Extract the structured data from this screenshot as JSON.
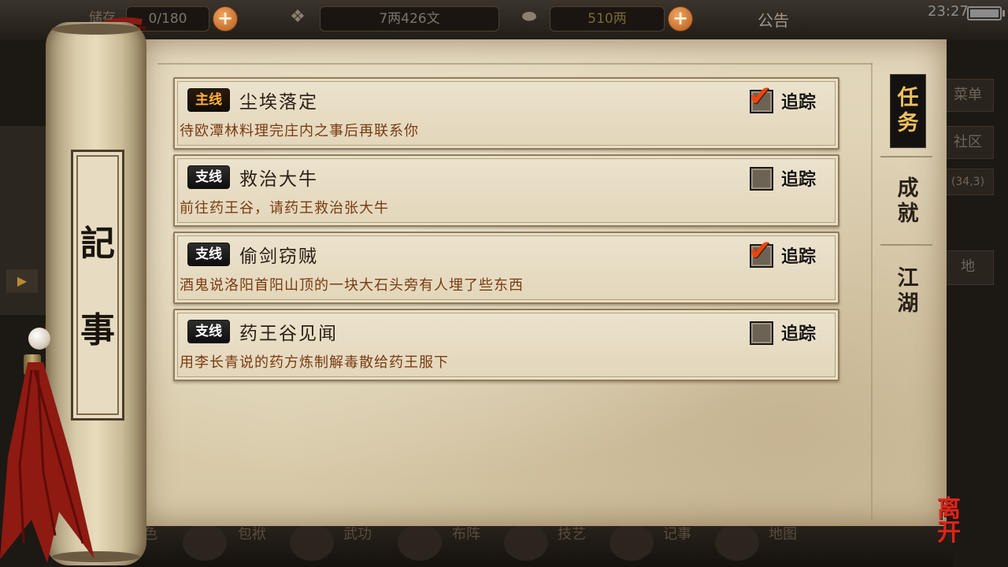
{
  "top_bar": {
    "storage_label": "储存",
    "storage_value": "0/180",
    "money": "7两426文",
    "gold": "510两",
    "notice": "公告",
    "time": "23:27"
  },
  "background_right_menu": [
    "菜单",
    "社区",
    "(34,3)",
    "地"
  ],
  "bottom_nav": [
    "角色",
    "包袱",
    "武功",
    "布阵",
    "技艺",
    "记事",
    "地图"
  ],
  "journal": {
    "title_chars": [
      "記",
      "事"
    ],
    "tabs": [
      {
        "label": "任务",
        "active": true
      },
      {
        "label": "成就",
        "active": false
      },
      {
        "label": "江湖",
        "active": false
      }
    ],
    "track_label": "追踪",
    "quests": [
      {
        "tag": "主线",
        "tag_type": "main",
        "title": "尘埃落定",
        "desc": "待欧潭林料理完庄内之事后再联系你",
        "tracked": true
      },
      {
        "tag": "支线",
        "tag_type": "side",
        "title": "救治大牛",
        "desc": "前往药王谷，请药王救治张大牛",
        "tracked": false
      },
      {
        "tag": "支线",
        "tag_type": "side",
        "title": "偷剑窃贼",
        "desc": "酒鬼说洛阳首阳山顶的一块大石头旁有人埋了些东西",
        "tracked": true
      },
      {
        "tag": "支线",
        "tag_type": "side",
        "title": "药王谷见闻",
        "desc": "用李长青说的药方炼制解毒散给药王服下",
        "tracked": false
      }
    ]
  },
  "leave_button": "离开",
  "colors": {
    "main_tag": "#ffb23a",
    "desc_text": "#7a3b12",
    "active_tab": "#f0c05a",
    "checkmark": "#e8470f",
    "leave": "#d8271c"
  }
}
